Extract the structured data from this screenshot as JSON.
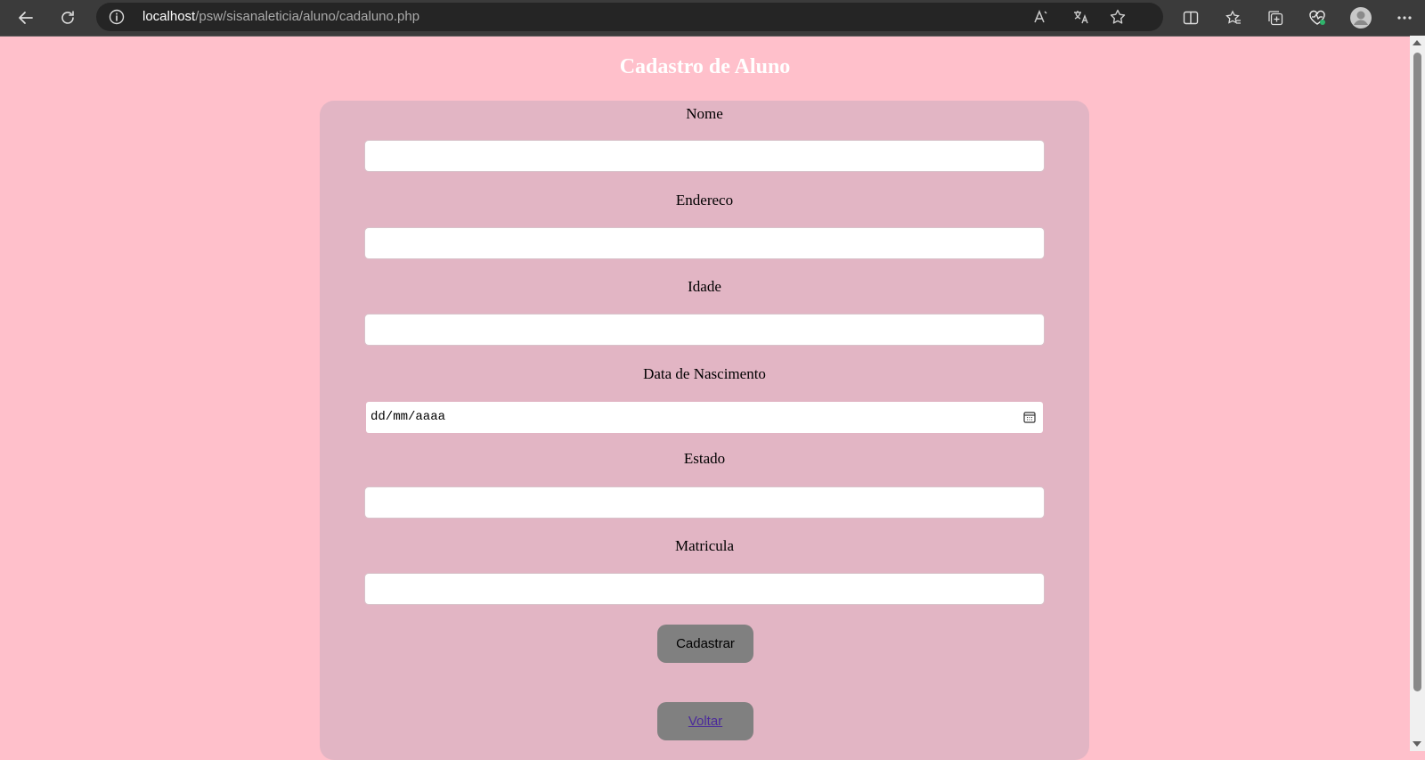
{
  "browser": {
    "url_host": "localhost",
    "url_path": "/psw/sisanaleticia/aluno/cadaluno.php"
  },
  "page": {
    "title": "Cadastro de Aluno"
  },
  "form": {
    "fields": [
      {
        "label": "Nome",
        "value": ""
      },
      {
        "label": "Endereco",
        "value": ""
      },
      {
        "label": "Idade",
        "value": ""
      },
      {
        "label": "Data de Nascimento",
        "placeholder": "dd/mm/aaaa"
      },
      {
        "label": "Estado",
        "value": ""
      },
      {
        "label": "Matricula",
        "value": ""
      }
    ],
    "submit_label": "Cadastrar",
    "back_label": "Voltar"
  },
  "colors": {
    "background": "#ffc0cb",
    "card": "#e2b5c4",
    "button": "#808080"
  }
}
